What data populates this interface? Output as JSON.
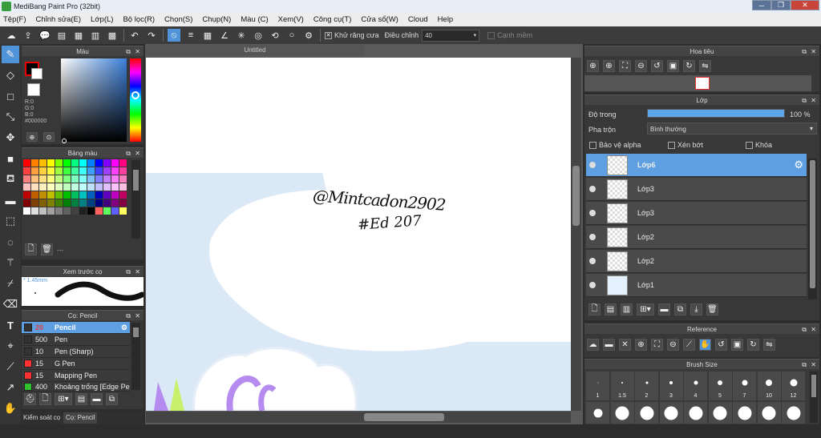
{
  "app": {
    "title": "MediBang Paint Pro (32bit)"
  },
  "menu": [
    "Tệp(F)",
    "Chỉnh sửa(E)",
    "Lớp(L)",
    "Bộ lọc(R)",
    "Chọn(S)",
    "Chụp(N)",
    "Màu (C)",
    "Xem(V)",
    "Công cụ(T)",
    "Cửa sổ(W)",
    "Cloud",
    "Help"
  ],
  "toolbar": {
    "antialias_label": "Khử răng cưa",
    "adjust_label": "Điều chỉnh",
    "adjust_value": "40",
    "smooth_label": "Cạnh mềm"
  },
  "color_panel": {
    "title": "Màu",
    "r": "R:0",
    "g": "G:0",
    "b": "B:0",
    "hex": "#000000",
    "accent": "#3b7fd8"
  },
  "palette_panel": {
    "title": "Bảng màu",
    "dash": "---",
    "colors": [
      "#ff0000",
      "#ff8000",
      "#ffbf00",
      "#ffff00",
      "#80ff00",
      "#00ff00",
      "#00ff80",
      "#00ffff",
      "#0080ff",
      "#0000ff",
      "#8000ff",
      "#ff00ff",
      "#ff0080",
      "#ff4040",
      "#ffa040",
      "#ffd040",
      "#ffff40",
      "#a0ff40",
      "#40ff40",
      "#40ffa0",
      "#40ffff",
      "#40a0ff",
      "#4040ff",
      "#a040ff",
      "#ff40ff",
      "#ff40a0",
      "#ff8080",
      "#ffc080",
      "#ffe080",
      "#ffff80",
      "#c0ff80",
      "#80ff80",
      "#80ffc0",
      "#80ffff",
      "#80c0ff",
      "#8080ff",
      "#c080ff",
      "#ff80ff",
      "#ff80c0",
      "#ffc0c0",
      "#ffe0c0",
      "#fff0c0",
      "#ffffc0",
      "#e0ffc0",
      "#c0ffc0",
      "#c0ffe0",
      "#c0ffff",
      "#c0e0ff",
      "#c0c0ff",
      "#e0c0ff",
      "#ffc0ff",
      "#ffc0e0",
      "#c00000",
      "#c06000",
      "#c09000",
      "#c0c000",
      "#60c000",
      "#00c000",
      "#00c060",
      "#00c0c0",
      "#0060c0",
      "#0000c0",
      "#6000c0",
      "#c000c0",
      "#c00060",
      "#800000",
      "#804000",
      "#806000",
      "#808000",
      "#408000",
      "#008000",
      "#008040",
      "#008080",
      "#004080",
      "#000080",
      "#400080",
      "#800080",
      "#800040",
      "#ffffff",
      "#e0e0e0",
      "#c0c0c0",
      "#a0a0a0",
      "#808080",
      "#606060",
      "#404040",
      "#202020",
      "#000000",
      "#ff6060",
      "#60ff60",
      "#6060ff",
      "#ffff60"
    ]
  },
  "preview_panel": {
    "title": "Xem trước cọ",
    "size": "1.45mm"
  },
  "brush_panel": {
    "title": "Cọ: Pencil",
    "brushes": [
      {
        "size": "20",
        "name": "Pencil",
        "color": "#333333"
      },
      {
        "size": "500",
        "name": "Pen",
        "color": "#333333"
      },
      {
        "size": "10",
        "name": "Pen (Sharp)",
        "color": "#333333"
      },
      {
        "size": "15",
        "name": "G Pen",
        "color": "#ff3030"
      },
      {
        "size": "15",
        "name": "Mapping Pen",
        "color": "#ff3030"
      },
      {
        "size": "400",
        "name": "Khoảng trống [Edge Pe",
        "color": "#30c030"
      }
    ]
  },
  "bottom_tabs": [
    "Kiểm soát cọ",
    "Cọ: Pencil"
  ],
  "document": {
    "tab_title": "Untitled",
    "signature_line1": "@Mintcadon2902",
    "signature_line2": "#Ed 207"
  },
  "nav_panel": {
    "title": "Hoa tiêu"
  },
  "layer_panel": {
    "title": "Lớp",
    "opacity_label": "Độ trong",
    "opacity_value": "100 %",
    "opacity": 100,
    "blend_label": "Pha trộn",
    "blend_value": "Bình thường",
    "protect_alpha": "Bảo vệ alpha",
    "clipping": "Xén bớt",
    "lock": "Khóa",
    "layers": [
      {
        "name": "Lớp6",
        "selected": true
      },
      {
        "name": "Lớp3",
        "selected": false
      },
      {
        "name": "Lớp3",
        "selected": false
      },
      {
        "name": "Lớp2",
        "selected": false
      },
      {
        "name": "Lớp2",
        "selected": false
      },
      {
        "name": "Lớp1",
        "selected": false
      }
    ]
  },
  "reference_panel": {
    "title": "Reference"
  },
  "brush_size_panel": {
    "title": "Brush Size",
    "sizes": [
      "1",
      "1.5",
      "2",
      "3",
      "4",
      "5",
      "7",
      "10",
      "12"
    ]
  }
}
